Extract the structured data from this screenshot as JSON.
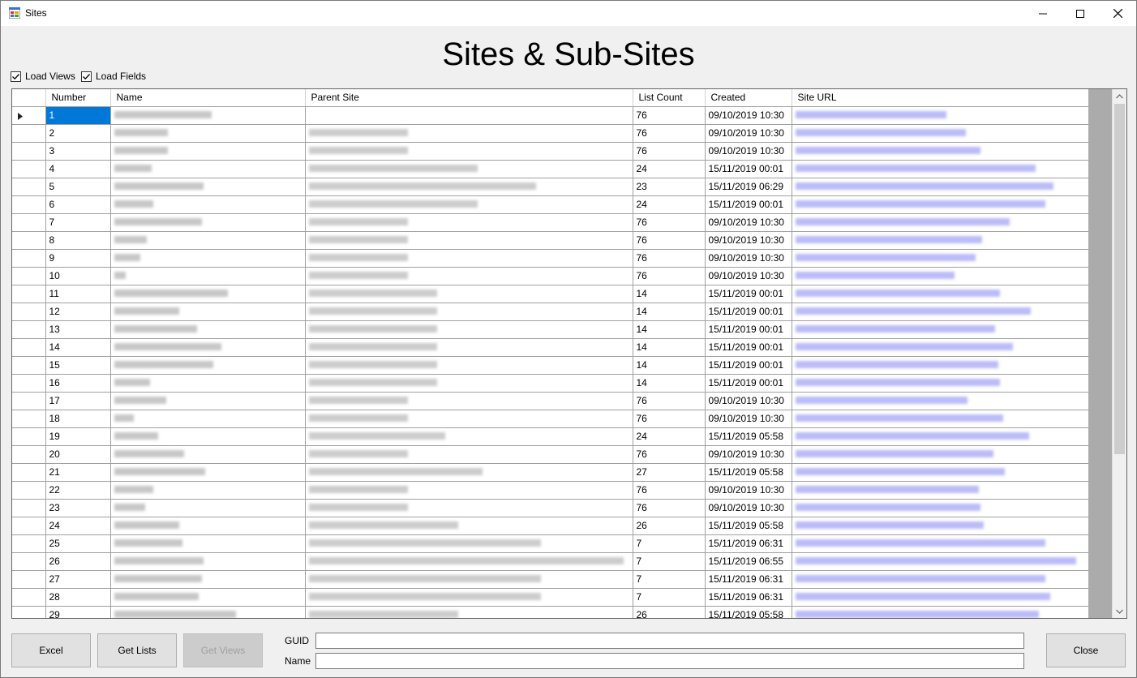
{
  "window": {
    "title": "Sites",
    "minimize_icon": "minimize-icon",
    "maximize_icon": "maximize-icon",
    "close_icon": "close-icon"
  },
  "heading": "Sites & Sub-Sites",
  "options": {
    "load_views": "Load Views",
    "load_views_checked": true,
    "load_fields": "Load Fields",
    "load_fields_checked": true
  },
  "grid": {
    "columns": [
      "Number",
      "Name",
      "Parent Site",
      "List Count",
      "Created",
      "Site URL"
    ],
    "rows": [
      {
        "number": "1",
        "list_count": "76",
        "created": "09/10/2019 10:30"
      },
      {
        "number": "2",
        "list_count": "76",
        "created": "09/10/2019 10:30"
      },
      {
        "number": "3",
        "list_count": "76",
        "created": "09/10/2019 10:30"
      },
      {
        "number": "4",
        "list_count": "24",
        "created": "15/11/2019 00:01"
      },
      {
        "number": "5",
        "list_count": "23",
        "created": "15/11/2019 06:29"
      },
      {
        "number": "6",
        "list_count": "24",
        "created": "15/11/2019 00:01"
      },
      {
        "number": "7",
        "list_count": "76",
        "created": "09/10/2019 10:30"
      },
      {
        "number": "8",
        "list_count": "76",
        "created": "09/10/2019 10:30"
      },
      {
        "number": "9",
        "list_count": "76",
        "created": "09/10/2019 10:30"
      },
      {
        "number": "10",
        "list_count": "76",
        "created": "09/10/2019 10:30"
      },
      {
        "number": "11",
        "list_count": "14",
        "created": "15/11/2019 00:01"
      },
      {
        "number": "12",
        "list_count": "14",
        "created": "15/11/2019 00:01"
      },
      {
        "number": "13",
        "list_count": "14",
        "created": "15/11/2019 00:01"
      },
      {
        "number": "14",
        "list_count": "14",
        "created": "15/11/2019 00:01"
      },
      {
        "number": "15",
        "list_count": "14",
        "created": "15/11/2019 00:01"
      },
      {
        "number": "16",
        "list_count": "14",
        "created": "15/11/2019 00:01"
      },
      {
        "number": "17",
        "list_count": "76",
        "created": "09/10/2019 10:30"
      },
      {
        "number": "18",
        "list_count": "76",
        "created": "09/10/2019 10:30"
      },
      {
        "number": "19",
        "list_count": "24",
        "created": "15/11/2019 05:58"
      },
      {
        "number": "20",
        "list_count": "76",
        "created": "09/10/2019 10:30"
      },
      {
        "number": "21",
        "list_count": "27",
        "created": "15/11/2019 05:58"
      },
      {
        "number": "22",
        "list_count": "76",
        "created": "09/10/2019 10:30"
      },
      {
        "number": "23",
        "list_count": "76",
        "created": "09/10/2019 10:30"
      },
      {
        "number": "24",
        "list_count": "26",
        "created": "15/11/2019 05:58"
      },
      {
        "number": "25",
        "list_count": "7",
        "created": "15/11/2019 06:31"
      },
      {
        "number": "26",
        "list_count": "7",
        "created": "15/11/2019 06:55"
      },
      {
        "number": "27",
        "list_count": "7",
        "created": "15/11/2019 06:31"
      },
      {
        "number": "28",
        "list_count": "7",
        "created": "15/11/2019 06:31"
      },
      {
        "number": "29",
        "list_count": "26",
        "created": "15/11/2019 05:58"
      }
    ],
    "selected_row": "1"
  },
  "buttons": {
    "excel": "Excel",
    "get_lists": "Get Lists",
    "get_views": "Get Views",
    "close": "Close"
  },
  "fields": {
    "guid_label": "GUID",
    "guid_value": "",
    "name_label": "Name",
    "name_value": ""
  }
}
